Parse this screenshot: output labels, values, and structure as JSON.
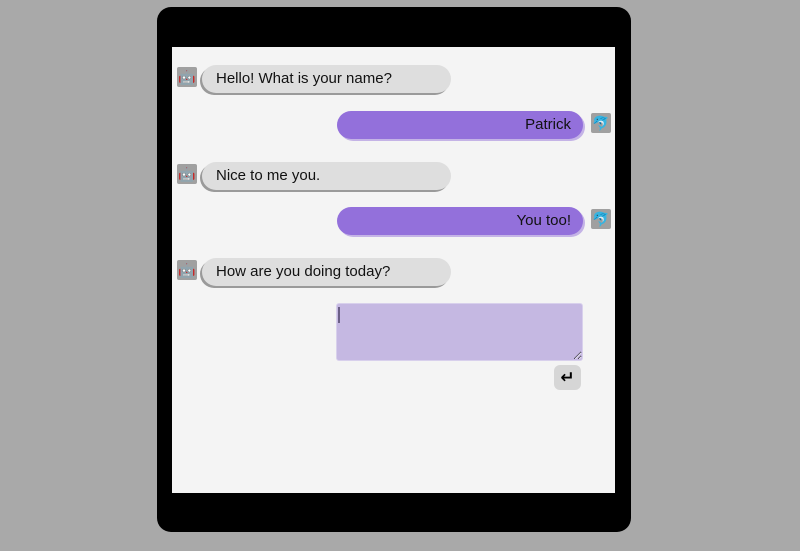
{
  "chat": {
    "messages": [
      {
        "sender": "bot",
        "avatar_icon": "robot-icon",
        "text": "Hello! What is your name?"
      },
      {
        "sender": "user",
        "avatar_icon": "dolphin-icon",
        "text": "Patrick"
      },
      {
        "sender": "bot",
        "avatar_icon": "robot-icon",
        "text": "Nice to me you."
      },
      {
        "sender": "user",
        "avatar_icon": "dolphin-icon",
        "text": "You too!"
      },
      {
        "sender": "bot",
        "avatar_icon": "robot-icon",
        "text": "How are you doing today?"
      }
    ],
    "icons": {
      "bot": "🤖",
      "user": "🐬"
    }
  },
  "composer": {
    "value": "",
    "placeholder": "",
    "send_label": "↵"
  },
  "colors": {
    "background": "#a9a9a9",
    "device_frame": "#000000",
    "screen": "#f4f4f4",
    "bot_bubble": "#dedede",
    "user_bubble": "#9370db",
    "input_bg": "#c5b8e2",
    "send_button": "#d6d6d6"
  }
}
